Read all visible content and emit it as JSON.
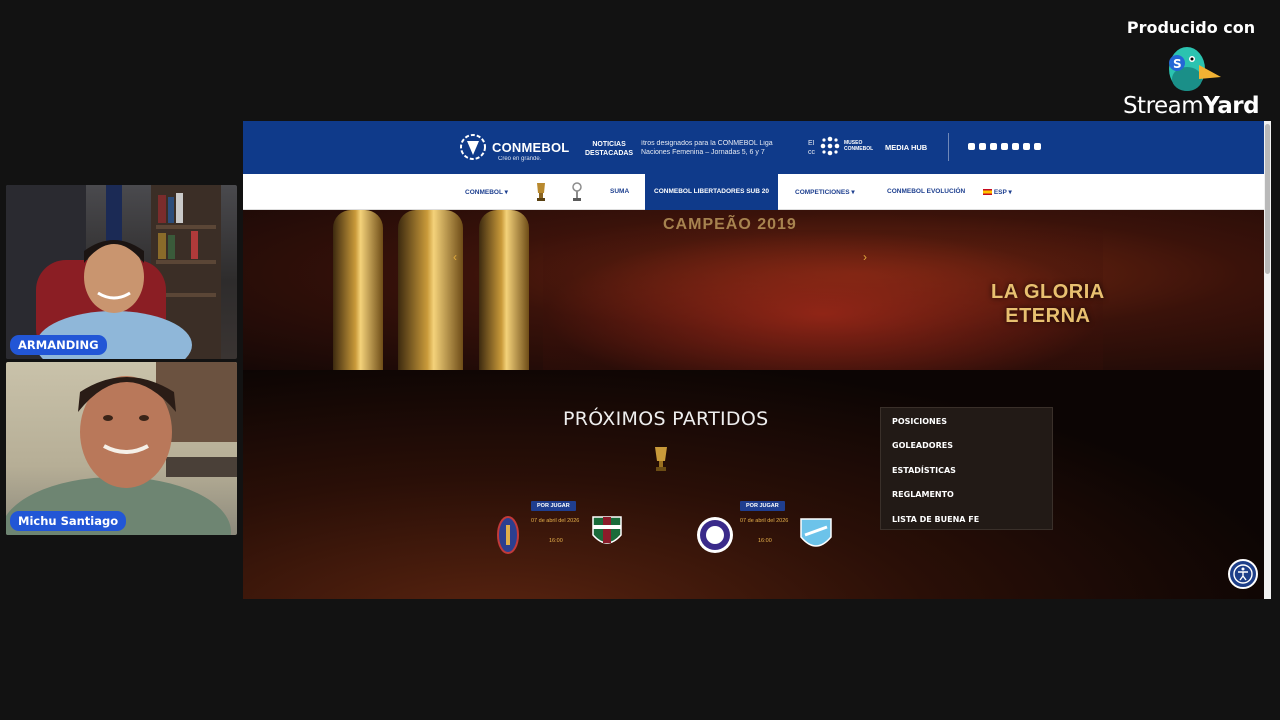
{
  "brand": {
    "caption": "Producido con",
    "name_light": "Stream",
    "name_bold": "Yard"
  },
  "participants": [
    {
      "name": "ARMANDING"
    },
    {
      "name": "Michu Santiago"
    }
  ],
  "site": {
    "logo_text": "CONMEBOL",
    "logo_tagline": "Creo en grande.",
    "noticias_line1": "NOTICIAS",
    "noticias_line2": "DESTACADAS",
    "ticker_line1": "ítros designados para la CONMEBOL Liga",
    "ticker_line2": "Naciones Femenina – Jornadas 5, 6 y 7",
    "ticker_left1": "El",
    "ticker_left2": "cc",
    "museo_line1": "MUSEO",
    "museo_line2": "CONMEBOL",
    "media_hub": "MEDIA HUB",
    "nav": {
      "conmebol": "CONMEBOL ▾",
      "suma": "SUMA",
      "active": "CONMEBOL LIBERTADORES SUB 20",
      "competiciones": "COMPETICIONES ▾",
      "evolucion": "CONMEBOL EVOLUCIÓN",
      "lang": "ESP ▾"
    },
    "hero": {
      "banner": "CAMPEÃO 2019",
      "title_line1": "LA GLORIA",
      "title_line2": "ETERNA"
    },
    "section_title": "PRÓXIMOS PARTIDOS",
    "matches": [
      {
        "status": "POR JUGAR",
        "date": "07 de abril del 2026",
        "time": "16:00"
      },
      {
        "status": "POR JUGAR",
        "date": "07 de abril del 2026",
        "time": "16:00"
      }
    ],
    "dropdown": [
      "POSICIONES",
      "GOLEADORES",
      "ESTADÍSTICAS",
      "REGLAMENTO",
      "LISTA DE BUENA FE"
    ]
  }
}
